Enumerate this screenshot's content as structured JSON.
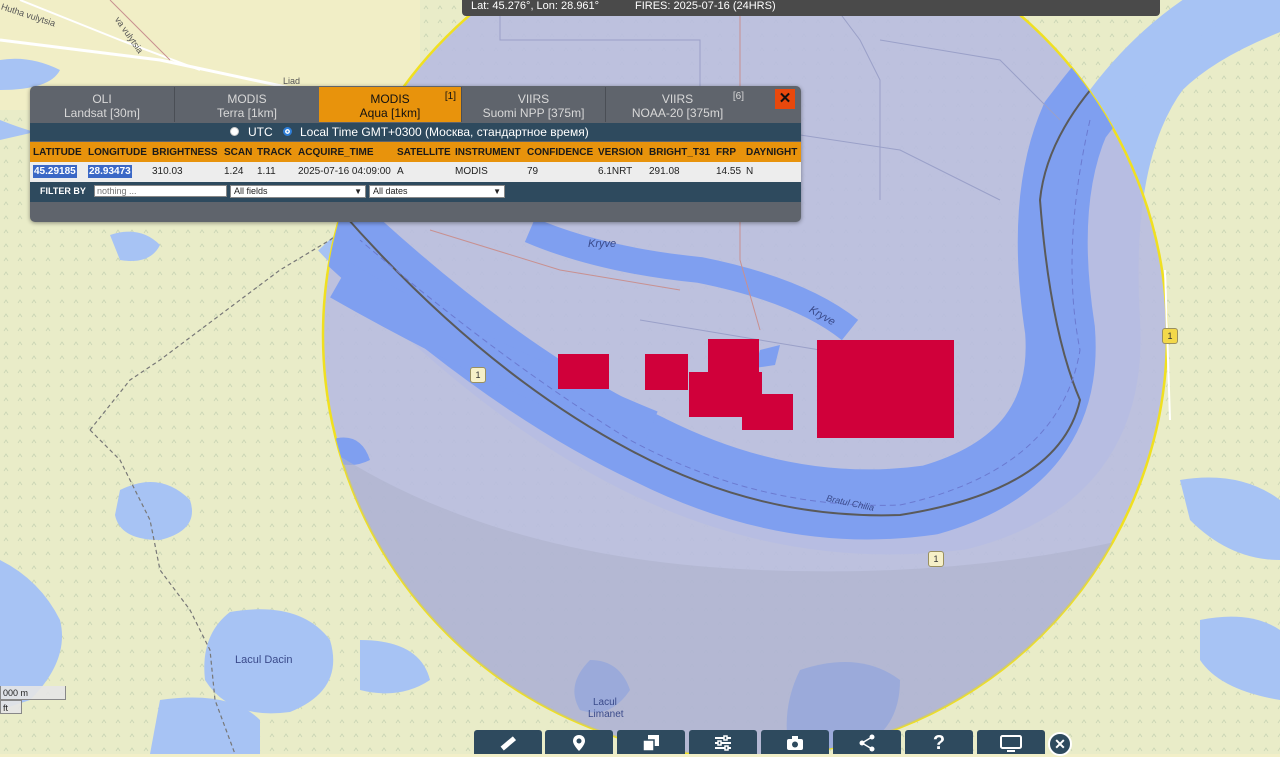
{
  "status_bar": {
    "coords": "Lat: 45.276°, Lon: 28.961°",
    "fires": "FIRES: 2025-07-16 (24HRS)"
  },
  "tabs": [
    {
      "line1": "OLI",
      "line2": "Landsat [30m]",
      "count": "",
      "active": false
    },
    {
      "line1": "MODIS",
      "line2": "Terra [1km]",
      "count": "",
      "active": false
    },
    {
      "line1": "MODIS",
      "line2": "Aqua [1km]",
      "count": "[1]",
      "active": true
    },
    {
      "line1": "VIIRS",
      "line2": "Suomi NPP [375m]",
      "count": "",
      "active": false
    },
    {
      "line1": "VIIRS",
      "line2": "NOAA-20 [375m]",
      "count": "[6]",
      "active": false
    }
  ],
  "close_label": "✕",
  "time_options": {
    "utc": "UTC",
    "local": "Local Time GMT+0300 (Москва, стандартное время)",
    "selected": "local"
  },
  "table": {
    "columns": [
      "LATITUDE",
      "LONGITUDE",
      "BRIGHTNESS",
      "SCAN",
      "TRACK",
      "ACQUIRE_TIME",
      "SATELLITE",
      "INSTRUMENT",
      "CONFIDENCE",
      "VERSION",
      "BRIGHT_T31",
      "FRP",
      "DAYNIGHT"
    ],
    "row": [
      "45.29185",
      "28.93473",
      "310.03",
      "1.24",
      "1.11",
      "2025-07-16 04:09:00",
      "A",
      "MODIS",
      "79",
      "6.1NRT",
      "291.08",
      "14.55",
      "N"
    ]
  },
  "filter": {
    "label": "FILTER BY",
    "placeholder": "nothing ...",
    "fields_value": "All fields",
    "dates_value": "All dates"
  },
  "map_labels": {
    "kryve_1": "Kryve",
    "kryve_2": "Kryve",
    "bratul": "Bratul Chilia",
    "lacul_dacin": "Lacul Dacin",
    "lacul_limanet_1": "Lacul",
    "lacul_limanet_2": "Limanet",
    "street": "Hutha vulytsia",
    "street2": "va vulytsia",
    "street3": "Liad",
    "road_badge": "1"
  },
  "scale": {
    "line1": "000 m",
    "line2": "ft"
  },
  "toolbar_icons": [
    "ruler-icon",
    "location-pin-icon",
    "copy-layers-icon",
    "sliders-icon",
    "camera-icon",
    "share-icon",
    "help-icon",
    "display-icon"
  ],
  "toolbar_help_glyph": "?",
  "toolbar_close": "✕",
  "colors": {
    "fire": "#d0003a",
    "accent": "#e8930c",
    "panel_dark": "#2e4a5e",
    "buffer_fill": "#a7acd8",
    "buffer_stroke": "#f0e020",
    "water": "#7f9ff0"
  }
}
